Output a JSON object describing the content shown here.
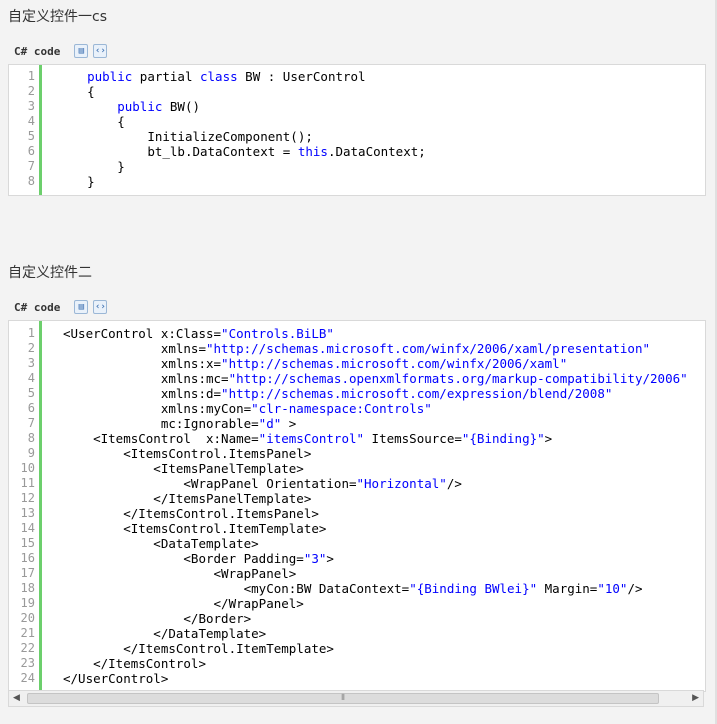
{
  "section1": {
    "heading": "自定义控件一cs",
    "lang": "C# code",
    "lines": [
      [
        [
          "kw",
          "public"
        ],
        [
          "tx",
          " partial "
        ],
        [
          "kw",
          "class"
        ],
        [
          "tx",
          " BW : UserControl"
        ]
      ],
      [
        [
          "tx",
          "{"
        ]
      ],
      [
        [
          "tx",
          "    "
        ],
        [
          "kw",
          "public"
        ],
        [
          "tx",
          " BW()"
        ]
      ],
      [
        [
          "tx",
          "    {"
        ]
      ],
      [
        [
          "tx",
          "        InitializeComponent();"
        ]
      ],
      [
        [
          "tx",
          "        bt_lb.DataContext = "
        ],
        [
          "kw",
          "this"
        ],
        [
          "tx",
          ".DataContext;"
        ]
      ],
      [
        [
          "tx",
          "    }"
        ]
      ],
      [
        [
          "tx",
          "}"
        ]
      ]
    ],
    "indent": "    "
  },
  "section2": {
    "heading": "自定义控件二",
    "lang": "C# code",
    "lines": [
      [
        [
          "tx",
          "<UserControl x:Class="
        ],
        [
          "str",
          "\"Controls.BiLB\""
        ]
      ],
      [
        [
          "tx",
          "             xmlns="
        ],
        [
          "str",
          "\"http://schemas.microsoft.com/winfx/2006/xaml/presentation\""
        ]
      ],
      [
        [
          "tx",
          "             xmlns:x="
        ],
        [
          "str",
          "\"http://schemas.microsoft.com/winfx/2006/xaml\""
        ]
      ],
      [
        [
          "tx",
          "             xmlns:mc="
        ],
        [
          "str",
          "\"http://schemas.openxmlformats.org/markup-compatibility/2006\""
        ]
      ],
      [
        [
          "tx",
          "             xmlns:d="
        ],
        [
          "str",
          "\"http://schemas.microsoft.com/expression/blend/2008\""
        ]
      ],
      [
        [
          "tx",
          "             xmlns:myCon="
        ],
        [
          "str",
          "\"clr-namespace:Controls\""
        ]
      ],
      [
        [
          "tx",
          "             mc:Ignorable="
        ],
        [
          "str",
          "\"d\""
        ],
        [
          "tx",
          " >"
        ]
      ],
      [
        [
          "tx",
          "    <ItemsControl  x:Name="
        ],
        [
          "str",
          "\"itemsControl\""
        ],
        [
          "tx",
          " ItemsSource="
        ],
        [
          "str",
          "\"{Binding}\""
        ],
        [
          "tx",
          ">"
        ]
      ],
      [
        [
          "tx",
          "        <ItemsControl.ItemsPanel>"
        ]
      ],
      [
        [
          "tx",
          "            <ItemsPanelTemplate>"
        ]
      ],
      [
        [
          "tx",
          "                <WrapPanel Orientation="
        ],
        [
          "str",
          "\"Horizontal\""
        ],
        [
          "tx",
          "/>"
        ]
      ],
      [
        [
          "tx",
          "            </ItemsPanelTemplate>"
        ]
      ],
      [
        [
          "tx",
          "        </ItemsControl.ItemsPanel>"
        ]
      ],
      [
        [
          "tx",
          "        <ItemsControl.ItemTemplate>"
        ]
      ],
      [
        [
          "tx",
          "            <DataTemplate>"
        ]
      ],
      [
        [
          "tx",
          "                <Border Padding="
        ],
        [
          "str",
          "\"3\""
        ],
        [
          "tx",
          ">"
        ]
      ],
      [
        [
          "tx",
          "                    <WrapPanel>"
        ]
      ],
      [
        [
          "tx",
          "                        <myCon:BW DataContext="
        ],
        [
          "str",
          "\"{Binding BWlei}\""
        ],
        [
          "tx",
          " Margin="
        ],
        [
          "str",
          "\"10\""
        ],
        [
          "tx",
          "/>"
        ]
      ],
      [
        [
          "tx",
          "                    </WrapPanel>"
        ]
      ],
      [
        [
          "tx",
          "                </Border>"
        ]
      ],
      [
        [
          "tx",
          "            </DataTemplate>"
        ]
      ],
      [
        [
          "tx",
          "        </ItemsControl.ItemTemplate>"
        ]
      ],
      [
        [
          "tx",
          "    </ItemsControl>"
        ]
      ],
      [
        [
          "tx",
          "</UserControl>"
        ]
      ]
    ]
  },
  "icons": {
    "copy": "copy-icon",
    "view_source": "view-source-icon"
  },
  "colors": {
    "keyword": "#0000ff",
    "gutter_bar": "#6ccf6c"
  }
}
